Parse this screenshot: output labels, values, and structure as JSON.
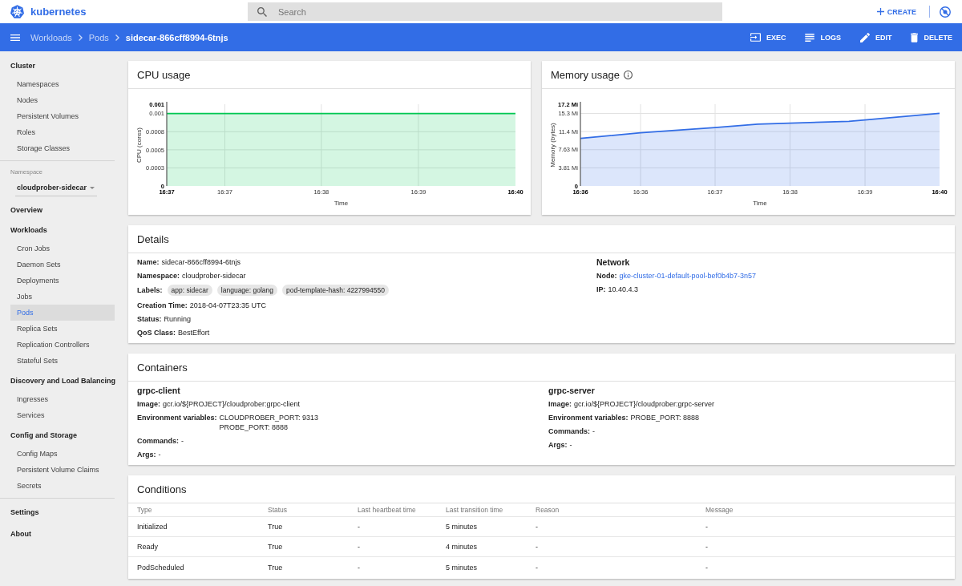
{
  "header": {
    "logo_text": "kubernetes",
    "search": {
      "placeholder": "Search"
    },
    "create": {
      "label": "CREATE"
    }
  },
  "toolbar": {
    "breadcrumbs": [
      "Workloads",
      "Pods",
      "sidecar-866cff8994-6tnjs"
    ],
    "actions": [
      {
        "kind": "exec",
        "label": "EXEC"
      },
      {
        "kind": "logs",
        "label": "LOGS"
      },
      {
        "kind": "edit",
        "label": "EDIT"
      },
      {
        "kind": "delete",
        "label": "DELETE"
      }
    ]
  },
  "sidebar": [
    {
      "kind": "section",
      "title": "Cluster",
      "items": [
        {
          "label": "Namespaces",
          "selected": false
        },
        {
          "label": "Nodes",
          "selected": false
        },
        {
          "label": "Persistent Volumes",
          "selected": false
        },
        {
          "label": "Roles",
          "selected": false
        },
        {
          "label": "Storage Classes",
          "selected": false
        }
      ]
    },
    {
      "kind": "divider"
    },
    {
      "kind": "namespace",
      "label": "Namespace",
      "value": "cloudprober-sidecar"
    },
    {
      "kind": "link",
      "label": "Overview",
      "selected": false
    },
    {
      "kind": "section",
      "title": "Workloads",
      "items": [
        {
          "label": "Cron Jobs",
          "selected": false
        },
        {
          "label": "Daemon Sets",
          "selected": false
        },
        {
          "label": "Deployments",
          "selected": false
        },
        {
          "label": "Jobs",
          "selected": false
        },
        {
          "label": "Pods",
          "selected": true
        },
        {
          "label": "Replica Sets",
          "selected": false
        },
        {
          "label": "Replication Controllers",
          "selected": false
        },
        {
          "label": "Stateful Sets",
          "selected": false
        }
      ]
    },
    {
      "kind": "section",
      "title": "Discovery and Load Balancing",
      "items": [
        {
          "label": "Ingresses",
          "selected": false
        },
        {
          "label": "Services",
          "selected": false
        }
      ]
    },
    {
      "kind": "section",
      "title": "Config and Storage",
      "items": [
        {
          "label": "Config Maps",
          "selected": false
        },
        {
          "label": "Persistent Volume Claims",
          "selected": false
        },
        {
          "label": "Secrets",
          "selected": false
        }
      ]
    },
    {
      "kind": "divider"
    },
    {
      "kind": "link",
      "label": "Settings",
      "selected": false
    },
    {
      "kind": "link",
      "label": "About",
      "selected": false
    }
  ],
  "charts": [
    {
      "title": "CPU usage",
      "info_icon": false,
      "chart_data": [
        {
          "type": "area",
          "xlabel": "Time",
          "ylabel": "CPU (cores)",
          "x": [
            16.6117,
            16.6217,
            16.6383,
            16.655,
            16.6717
          ],
          "values": [
            0.001,
            0.001,
            0.001,
            0.001,
            0.001
          ],
          "color": "#00c752",
          "xlim": [
            16.6117,
            16.6717
          ],
          "ylim": [
            0,
            0.00113
          ],
          "xticks": [
            {
              "value": 16.6117,
              "label": "16:37"
            },
            {
              "value": 16.6217,
              "label": "16:37"
            },
            {
              "value": 16.6383,
              "label": "16:38"
            },
            {
              "value": 16.655,
              "label": "16:39"
            },
            {
              "value": 16.6717,
              "label": "16:40"
            }
          ],
          "yticks": [
            0,
            {
              "value": 0.00025,
              "label": "0.0003"
            },
            0.0005,
            {
              "value": 0.00075,
              "label": "0.0008"
            },
            0.001,
            {
              "value": 0.00113,
              "label": "0.001"
            }
          ],
          "grid": true
        }
      ]
    },
    {
      "title": "Memory usage",
      "info_icon": true,
      "chart_data": [
        {
          "type": "area",
          "xlabel": "Time",
          "ylabel": "Memory (bytes)",
          "x": [
            16.5933,
            16.6067,
            16.6233,
            16.6328,
            16.64,
            16.6531,
            16.6567,
            16.6733
          ],
          "values": [
            10.0,
            11.2,
            12.3,
            13.0,
            13.2,
            13.6,
            13.9,
            15.3
          ],
          "color": "#326de6",
          "xlim": [
            16.5933,
            16.6733
          ],
          "ylim": [
            0,
            17.2
          ],
          "xticks": [
            {
              "value": 16.5933,
              "label": "16:36"
            },
            {
              "value": 16.6067,
              "label": "16:36"
            },
            {
              "value": 16.6233,
              "label": "16:37"
            },
            {
              "value": 16.64,
              "label": "16:38"
            },
            {
              "value": 16.6567,
              "label": "16:39"
            },
            {
              "value": 16.6733,
              "label": "16:40"
            }
          ],
          "yticks": [
            0,
            {
              "value": 3.81,
              "label": "3.81 Mi"
            },
            {
              "value": 7.63,
              "label": "7.63 Mi"
            },
            {
              "value": 11.44,
              "label": "11.4 Mi"
            },
            {
              "value": 15.26,
              "label": "15.3 Mi"
            },
            {
              "value": 17.2,
              "label": "17.2 Mi"
            }
          ],
          "grid": true
        }
      ]
    }
  ],
  "details": {
    "title": "Details",
    "fields": [
      {
        "kind": "text",
        "label": "Name:",
        "value": "sidecar-866cff8994-6tnjs"
      },
      {
        "kind": "text",
        "label": "Namespace:",
        "value": "cloudprober-sidecar"
      },
      {
        "kind": "chips",
        "label": "Labels:",
        "values": [
          "app: sidecar",
          "language: golang",
          "pod-template-hash: 4227994550"
        ]
      },
      {
        "kind": "text",
        "label": "Creation Time:",
        "value": "2018-04-07T23:35 UTC"
      },
      {
        "kind": "text",
        "label": "Status:",
        "value": "Running"
      },
      {
        "kind": "text",
        "label": "QoS Class:",
        "value": "BestEffort"
      }
    ],
    "network": {
      "title": "Network",
      "fields": [
        {
          "kind": "link",
          "label": "Node:",
          "value": "gke-cluster-01-default-pool-bef0b4b7-3n57"
        },
        {
          "kind": "text",
          "label": "IP:",
          "value": "10.40.4.3"
        }
      ]
    }
  },
  "containers": {
    "title": "Containers",
    "items": [
      {
        "name": "grpc-client",
        "fields": [
          {
            "label": "Image:",
            "values": [
              "gcr.io/${PROJECT}/cloudprober:grpc-client"
            ]
          },
          {
            "label": "Environment variables:",
            "values": [
              "CLOUDPROBER_PORT: 9313",
              "PROBE_PORT: 8888"
            ]
          },
          {
            "label": "Commands:",
            "values": [
              "-"
            ]
          },
          {
            "label": "Args:",
            "values": [
              "-"
            ]
          }
        ]
      },
      {
        "name": "grpc-server",
        "fields": [
          {
            "label": "Image:",
            "values": [
              "gcr.io/${PROJECT}/cloudprober:grpc-server"
            ]
          },
          {
            "label": "Environment variables:",
            "values": [
              "PROBE_PORT: 8888"
            ]
          },
          {
            "label": "Commands:",
            "values": [
              "-"
            ]
          },
          {
            "label": "Args:",
            "values": [
              "-"
            ]
          }
        ]
      }
    ]
  },
  "conditions": {
    "title": "Conditions",
    "columns": [
      "Type",
      "Status",
      "Last heartbeat time",
      "Last transition time",
      "Reason",
      "Message"
    ],
    "rows": [
      [
        "Initialized",
        "True",
        "-",
        "5 minutes",
        "-",
        "-"
      ],
      [
        "Ready",
        "True",
        "-",
        "4 minutes",
        "-",
        "-"
      ],
      [
        "PodScheduled",
        "True",
        "-",
        "5 minutes",
        "-",
        "-"
      ]
    ]
  }
}
